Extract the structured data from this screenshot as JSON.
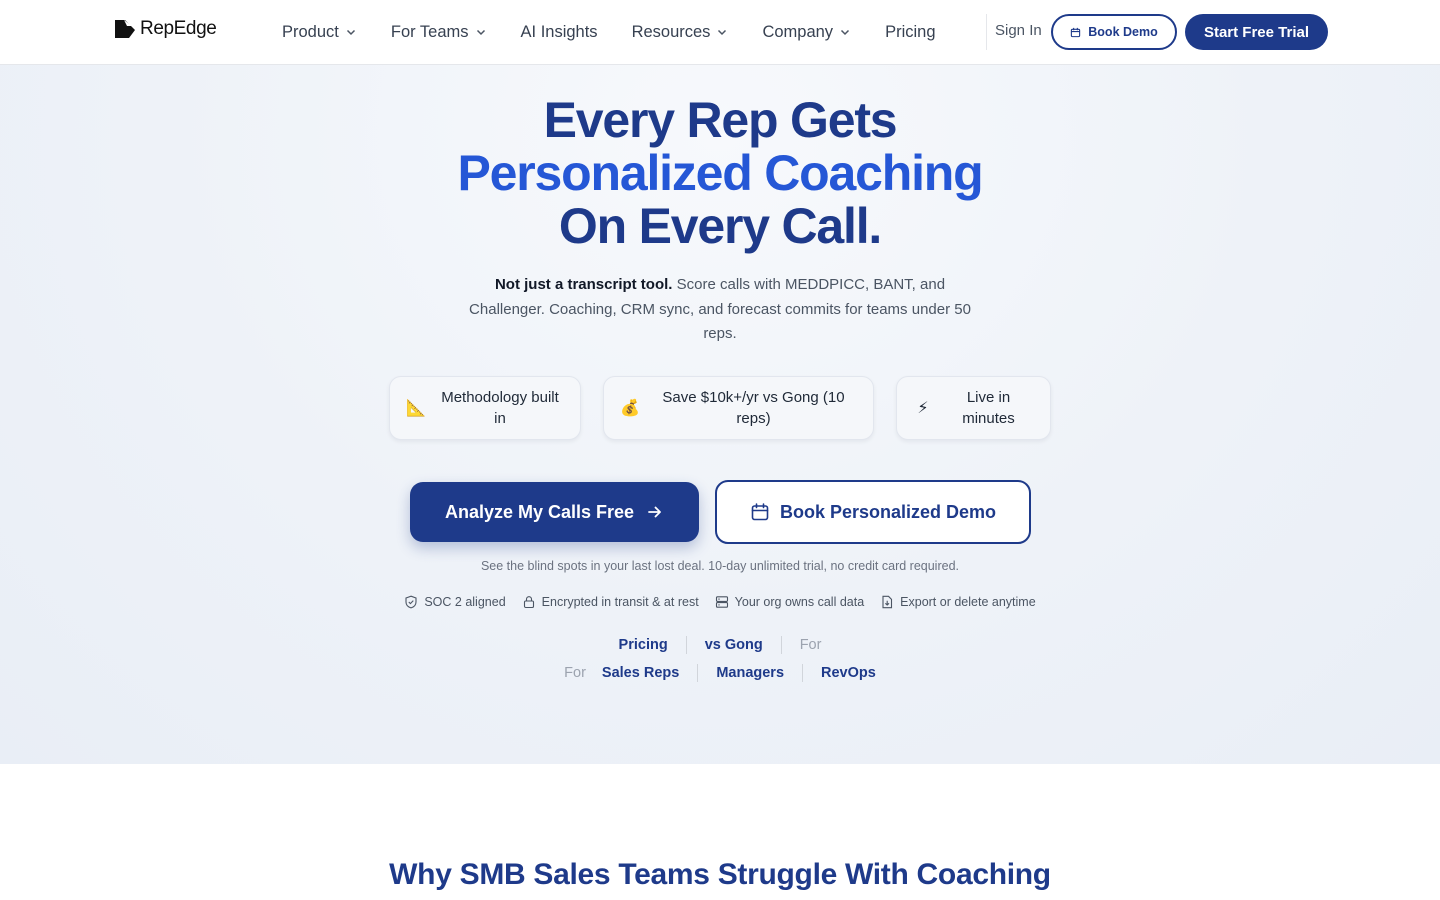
{
  "nav": {
    "brand": "RepEdge",
    "links": [
      {
        "label": "Product",
        "dropdown": true
      },
      {
        "label": "For Teams",
        "dropdown": true
      },
      {
        "label": "AI Insights",
        "dropdown": false
      },
      {
        "label": "Resources",
        "dropdown": true
      },
      {
        "label": "Company",
        "dropdown": true
      },
      {
        "label": "Pricing",
        "dropdown": false
      }
    ],
    "sign_in": "Sign In",
    "book_demo": "Book Demo",
    "start_trial": "Start Free Trial"
  },
  "hero": {
    "headline_line1": "Every Rep Gets",
    "headline_line2": "Personalized Coaching",
    "headline_line3": "On Every Call.",
    "sub_bold": "Not just a transcript tool.",
    "sub_rest": " Score calls with MEDDPICC, BANT, and Challenger. Coaching, CRM sync, and forecast commits for teams under 50 reps.",
    "pills": [
      {
        "icon": "triangular-ruler-icon",
        "glyph": "📐",
        "label": "Methodology built in"
      },
      {
        "icon": "money-bag-icon",
        "glyph": "💰",
        "label": "Save $10k+/yr vs Gong (10 reps)"
      },
      {
        "icon": "lightning-icon",
        "glyph": "⚡",
        "label": "Live in minutes"
      }
    ],
    "cta_primary": "Analyze My Calls Free",
    "cta_secondary": "Book Personalized Demo",
    "fineprint": "See the blind spots in your last lost deal. 10-day unlimited trial, no credit card required.",
    "trust": [
      {
        "icon": "shield-check-icon",
        "label": "SOC 2 aligned"
      },
      {
        "icon": "lock-icon",
        "label": "Encrypted in transit & at rest"
      },
      {
        "icon": "server-icon",
        "label": "Your org owns call data"
      },
      {
        "icon": "file-download-icon",
        "label": "Export or delete anytime"
      }
    ],
    "links_row1": {
      "pricing": "Pricing",
      "vs_gong": "vs Gong",
      "for": "For"
    },
    "links_row2": {
      "for": "For",
      "sales_reps": "Sales Reps",
      "managers": "Managers",
      "revops": "RevOps"
    }
  },
  "section": {
    "title": "Why SMB Sales Teams Struggle With Coaching"
  },
  "colors": {
    "brand_navy": "#1e3a8a",
    "accent_blue": "#2557d6",
    "hero_bg": "#eef2f8"
  }
}
